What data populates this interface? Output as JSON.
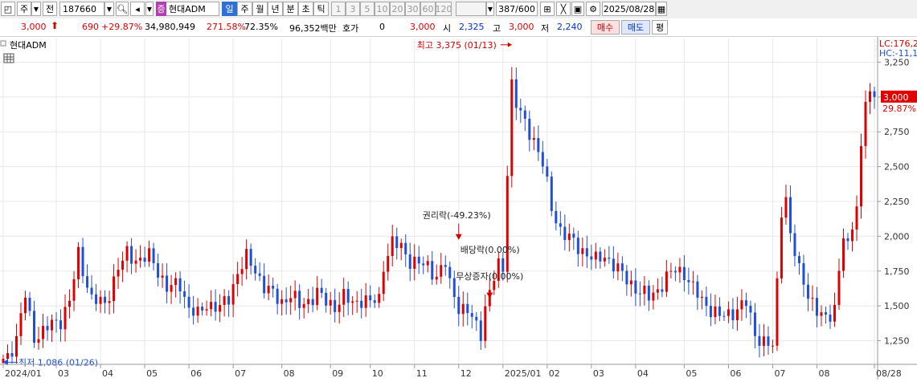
{
  "toolbar": {
    "period_label": "주",
    "prev_label": "전",
    "code": "187660",
    "market_badge": "증",
    "name": "현대ADM",
    "interval_tabs": [
      "일",
      "주",
      "월",
      "년",
      "분",
      "초",
      "틱"
    ],
    "minute_options": [
      "1",
      "3",
      "5",
      "10",
      "20",
      "30",
      "60",
      "120"
    ],
    "count": "387/600",
    "date": "2025/08/28"
  },
  "infobar": {
    "price": "3,000",
    "change": "690",
    "change_pct": "+29.87%",
    "volume": "34,980,949",
    "volume_ratio": "271.58%",
    "turnover": "72.35%",
    "amount": "96,352백만",
    "quote_label": "호가",
    "quote_value": "0",
    "quote_price": "3,000",
    "open_label": "시",
    "open": "2,325",
    "high_label": "고",
    "high": "3,000",
    "low_label": "저",
    "low": "2,240",
    "buy_label": "매수",
    "sell_label": "매도",
    "avg_label": "평"
  },
  "chart_data": {
    "type": "candlestick",
    "title": "현대ADM",
    "ylim": [
      1080,
      3420
    ],
    "y_ticks": [
      1250,
      1500,
      1750,
      2000,
      2250,
      2500,
      2750,
      3000,
      3250
    ],
    "y_tick_labels": [
      "1,250",
      "1,500",
      "1,750",
      "2,000",
      "2,250",
      "2,500",
      "2,750",
      "3,000",
      "3,250"
    ],
    "x_ticks": [
      {
        "label": "2024/01",
        "index": 0
      },
      {
        "label": "03",
        "index": 12
      },
      {
        "label": "04",
        "index": 22
      },
      {
        "label": "05",
        "index": 32
      },
      {
        "label": "06",
        "index": 42
      },
      {
        "label": "07",
        "index": 52
      },
      {
        "label": "08",
        "index": 63
      },
      {
        "label": "09",
        "index": 74
      },
      {
        "label": "10",
        "index": 83
      },
      {
        "label": "11",
        "index": 93
      },
      {
        "label": "12",
        "index": 103
      },
      {
        "label": "2025/01",
        "index": 113
      },
      {
        "label": "02",
        "index": 123
      },
      {
        "label": "03",
        "index": 133
      },
      {
        "label": "04",
        "index": 143
      },
      {
        "label": "05",
        "index": 154
      },
      {
        "label": "06",
        "index": 164
      },
      {
        "label": "07",
        "index": 174
      },
      {
        "label": "08",
        "index": 184
      },
      {
        "label": "08/28",
        "index": 197
      }
    ],
    "close_path": [
      [
        0,
        1100
      ],
      [
        3,
        1250
      ],
      [
        5,
        1580
      ],
      [
        7,
        1280
      ],
      [
        9,
        1300
      ],
      [
        11,
        1380
      ],
      [
        13,
        1400
      ],
      [
        15,
        1520
      ],
      [
        17,
        1880
      ],
      [
        20,
        1540
      ],
      [
        23,
        1520
      ],
      [
        26,
        1760
      ],
      [
        28,
        1880
      ],
      [
        31,
        1820
      ],
      [
        33,
        1860
      ],
      [
        35,
        1760
      ],
      [
        37,
        1620
      ],
      [
        40,
        1660
      ],
      [
        42,
        1480
      ],
      [
        44,
        1430
      ],
      [
        46,
        1520
      ],
      [
        49,
        1480
      ],
      [
        51,
        1560
      ],
      [
        53,
        1740
      ],
      [
        55,
        1840
      ],
      [
        57,
        1760
      ],
      [
        59,
        1640
      ],
      [
        61,
        1580
      ],
      [
        63,
        1530
      ],
      [
        65,
        1580
      ],
      [
        67,
        1500
      ],
      [
        69,
        1540
      ],
      [
        71,
        1590
      ],
      [
        73,
        1530
      ],
      [
        75,
        1500
      ],
      [
        77,
        1560
      ],
      [
        79,
        1520
      ],
      [
        81,
        1550
      ],
      [
        83,
        1520
      ],
      [
        85,
        1550
      ],
      [
        86,
        1800
      ],
      [
        88,
        1950
      ],
      [
        90,
        1920
      ],
      [
        92,
        1830
      ],
      [
        94,
        1800
      ],
      [
        96,
        1780
      ],
      [
        98,
        1720
      ],
      [
        100,
        1800
      ],
      [
        101,
        1650
      ],
      [
        103,
        1500
      ],
      [
        105,
        1460
      ],
      [
        107,
        1350
      ],
      [
        108,
        1310
      ],
      [
        109,
        1500
      ],
      [
        111,
        1700
      ],
      [
        112,
        1780
      ],
      [
        113,
        1760
      ],
      [
        114,
        2480
      ],
      [
        115,
        3100
      ],
      [
        116,
        2950
      ],
      [
        118,
        2800
      ],
      [
        120,
        2700
      ],
      [
        122,
        2520
      ],
      [
        124,
        2200
      ],
      [
        126,
        2050
      ],
      [
        128,
        1980
      ],
      [
        130,
        1920
      ],
      [
        132,
        1880
      ],
      [
        134,
        1820
      ],
      [
        136,
        1860
      ],
      [
        138,
        1800
      ],
      [
        140,
        1720
      ],
      [
        142,
        1660
      ],
      [
        144,
        1600
      ],
      [
        146,
        1560
      ],
      [
        148,
        1620
      ],
      [
        150,
        1700
      ],
      [
        152,
        1760
      ],
      [
        154,
        1740
      ],
      [
        156,
        1620
      ],
      [
        158,
        1540
      ],
      [
        160,
        1480
      ],
      [
        162,
        1420
      ],
      [
        164,
        1440
      ],
      [
        166,
        1480
      ],
      [
        168,
        1520
      ],
      [
        170,
        1300
      ],
      [
        172,
        1240
      ],
      [
        174,
        1200
      ],
      [
        175,
        1660
      ],
      [
        176,
        2200
      ],
      [
        177,
        2280
      ],
      [
        178,
        2000
      ],
      [
        180,
        1750
      ],
      [
        182,
        1600
      ],
      [
        184,
        1450
      ],
      [
        186,
        1400
      ],
      [
        188,
        1500
      ],
      [
        190,
        2000
      ],
      [
        191,
        1900
      ],
      [
        193,
        2250
      ],
      [
        195,
        3000
      ]
    ],
    "annotations": {
      "high": "최고 3,375 (01/13)",
      "low": "최저 1,086 (01/26)",
      "rights": "권리락(-49.23%)",
      "dividend": "배당락(0.00%)",
      "capital": "무상증자(0.00%)"
    },
    "right_labels": {
      "lc": "LC:176,2",
      "hc": "HC:-11,1",
      "last_price": "3,000",
      "last_pct": "29.87%"
    },
    "colors": {
      "up": "#e00000",
      "down": "#1f4fd8",
      "grid": "#e8e8e8"
    }
  }
}
